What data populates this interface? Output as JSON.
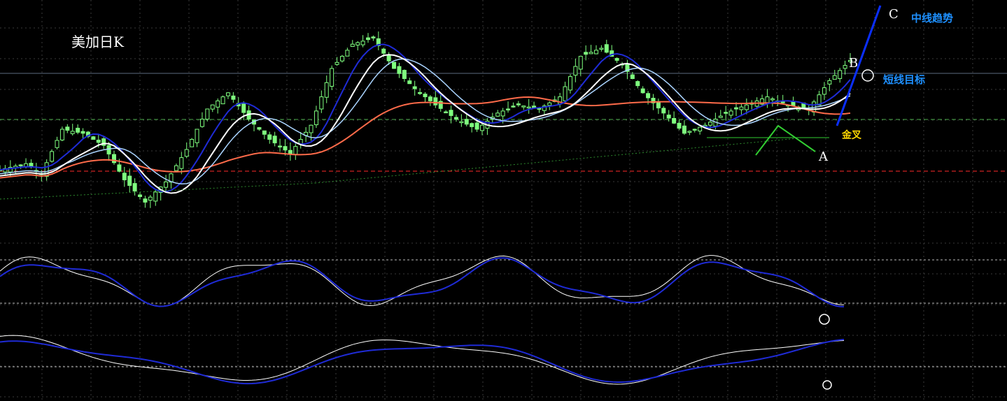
{
  "chart_title": "美加日K",
  "annotations": {
    "point_a": "A",
    "point_b": "B",
    "point_c": "C",
    "mid_trend": "中线趋势",
    "short_target": "短线目标",
    "golden_cross": "金叉"
  },
  "colors": {
    "background": "#000000",
    "bull_candle": "#7fff7f",
    "bear_candle": "#7fff7f",
    "ma_fast": "#ffffff",
    "ma_mid": "#aad4ff",
    "ma_slow": "#ff6b4a",
    "ma_blue": "#1f2bd6",
    "support_line": "#ff2a2a",
    "annotation_blue": "#1e90ff",
    "annotation_gold": "#ffd700"
  },
  "chart_data": {
    "type": "candlestick",
    "title": "美加日K",
    "price_panel": {
      "price_range": [
        0,
        100
      ],
      "candles_sampled": true,
      "close_path": [
        {
          "t": 0,
          "v": 30
        },
        {
          "t": 5,
          "v": 33
        },
        {
          "t": 8,
          "v": 28
        },
        {
          "t": 12,
          "v": 50
        },
        {
          "t": 16,
          "v": 48
        },
        {
          "t": 20,
          "v": 42
        },
        {
          "t": 24,
          "v": 25
        },
        {
          "t": 28,
          "v": 14
        },
        {
          "t": 32,
          "v": 24
        },
        {
          "t": 36,
          "v": 40
        },
        {
          "t": 40,
          "v": 60
        },
        {
          "t": 44,
          "v": 68
        },
        {
          "t": 48,
          "v": 55
        },
        {
          "t": 52,
          "v": 45
        },
        {
          "t": 56,
          "v": 38
        },
        {
          "t": 60,
          "v": 52
        },
        {
          "t": 64,
          "v": 80
        },
        {
          "t": 68,
          "v": 92
        },
        {
          "t": 72,
          "v": 95
        },
        {
          "t": 76,
          "v": 80
        },
        {
          "t": 80,
          "v": 70
        },
        {
          "t": 84,
          "v": 62
        },
        {
          "t": 88,
          "v": 55
        },
        {
          "t": 92,
          "v": 50
        },
        {
          "t": 96,
          "v": 58
        },
        {
          "t": 100,
          "v": 62
        },
        {
          "t": 104,
          "v": 60
        },
        {
          "t": 108,
          "v": 66
        },
        {
          "t": 112,
          "v": 86
        },
        {
          "t": 116,
          "v": 90
        },
        {
          "t": 120,
          "v": 82
        },
        {
          "t": 124,
          "v": 68
        },
        {
          "t": 128,
          "v": 58
        },
        {
          "t": 132,
          "v": 48
        },
        {
          "t": 136,
          "v": 52
        },
        {
          "t": 140,
          "v": 58
        },
        {
          "t": 144,
          "v": 62
        },
        {
          "t": 148,
          "v": 66
        },
        {
          "t": 152,
          "v": 62
        },
        {
          "t": 156,
          "v": 60
        },
        {
          "t": 160,
          "v": 74
        },
        {
          "t": 164,
          "v": 84
        }
      ]
    },
    "moving_averages": [
      {
        "name": "white",
        "color": "#ffffff"
      },
      {
        "name": "light-blue",
        "color": "#aad4ff"
      },
      {
        "name": "red",
        "color": "#ff6b4a"
      },
      {
        "name": "blue",
        "color": "#1f2bd6"
      }
    ],
    "oscillator_1": {
      "range": [
        0,
        100
      ]
    },
    "oscillator_2": {
      "range": [
        0,
        100
      ]
    }
  }
}
